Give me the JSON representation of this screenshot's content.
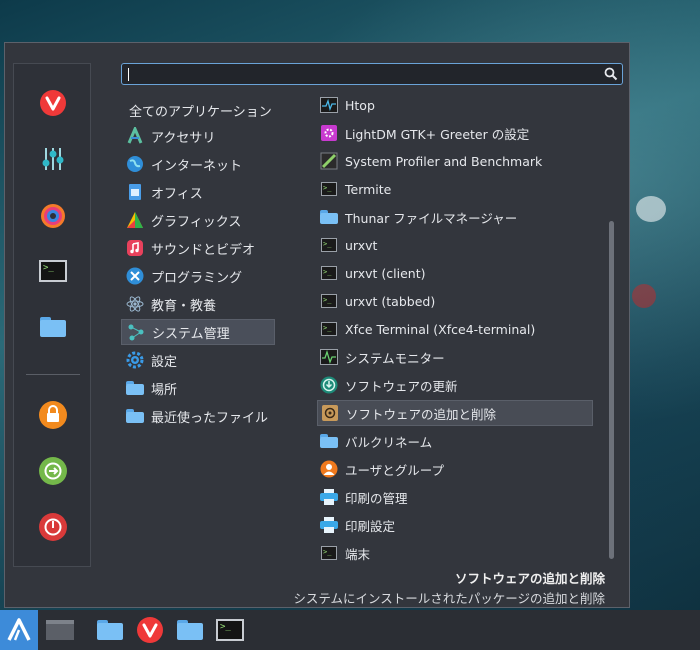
{
  "search": {
    "value": ""
  },
  "categories_header": "全てのアプリケーション",
  "categories": [
    {
      "label": "アクセサリ",
      "icon": "accessories-icon"
    },
    {
      "label": "インターネット",
      "icon": "internet-icon"
    },
    {
      "label": "オフィス",
      "icon": "office-icon"
    },
    {
      "label": "グラフィックス",
      "icon": "graphics-icon"
    },
    {
      "label": "サウンドとビデオ",
      "icon": "multimedia-icon"
    },
    {
      "label": "プログラミング",
      "icon": "development-icon"
    },
    {
      "label": "教育・教養",
      "icon": "education-icon"
    },
    {
      "label": "システム管理",
      "icon": "system-icon"
    },
    {
      "label": "設定",
      "icon": "settings-icon"
    },
    {
      "label": "場所",
      "icon": "places-folder-icon"
    },
    {
      "label": "最近使ったファイル",
      "icon": "recent-files-icon"
    }
  ],
  "apps": [
    {
      "label": "Htop",
      "icon": "htop-icon"
    },
    {
      "label": "LightDM GTK+ Greeter の設定",
      "icon": "lightdm-icon"
    },
    {
      "label": "System Profiler and Benchmark",
      "icon": "hardinfo-icon"
    },
    {
      "label": "Termite",
      "icon": "terminal-icon"
    },
    {
      "label": "Thunar ファイルマネージャー",
      "icon": "folder-icon"
    },
    {
      "label": "urxvt",
      "icon": "terminal-icon"
    },
    {
      "label": "urxvt (client)",
      "icon": "terminal-icon"
    },
    {
      "label": "urxvt (tabbed)",
      "icon": "terminal-icon"
    },
    {
      "label": "Xfce Terminal (Xfce4-terminal)",
      "icon": "terminal-icon"
    },
    {
      "label": "システムモニター",
      "icon": "system-monitor-icon"
    },
    {
      "label": "ソフトウェアの更新",
      "icon": "software-update-icon"
    },
    {
      "label": "ソフトウェアの追加と削除",
      "icon": "package-manager-icon"
    },
    {
      "label": "バルクリネーム",
      "icon": "folder-icon"
    },
    {
      "label": "ユーザとグループ",
      "icon": "users-icon"
    },
    {
      "label": "印刷の管理",
      "icon": "printer-icon"
    },
    {
      "label": "印刷設定",
      "icon": "printer-icon"
    },
    {
      "label": "端末",
      "icon": "terminal-icon"
    }
  ],
  "description": {
    "title": "ソフトウェアの追加と削除",
    "text": "システムにインストールされたパッケージの追加と削除"
  },
  "favorites": [
    "vivaldi-icon",
    "settings-sliders-icon",
    "color-picker-icon",
    "terminal-icon",
    "folder-icon"
  ],
  "session": [
    "lock-icon",
    "logout-icon",
    "power-icon"
  ],
  "taskbar": [
    "start-menu-icon",
    "window-icon",
    "folder-icon",
    "vivaldi-icon",
    "folder-icon",
    "terminal-icon"
  ],
  "colors": {
    "accent": "#3d8bd9",
    "menu_bg": "#33363d",
    "selection": "#4a4f5a"
  }
}
